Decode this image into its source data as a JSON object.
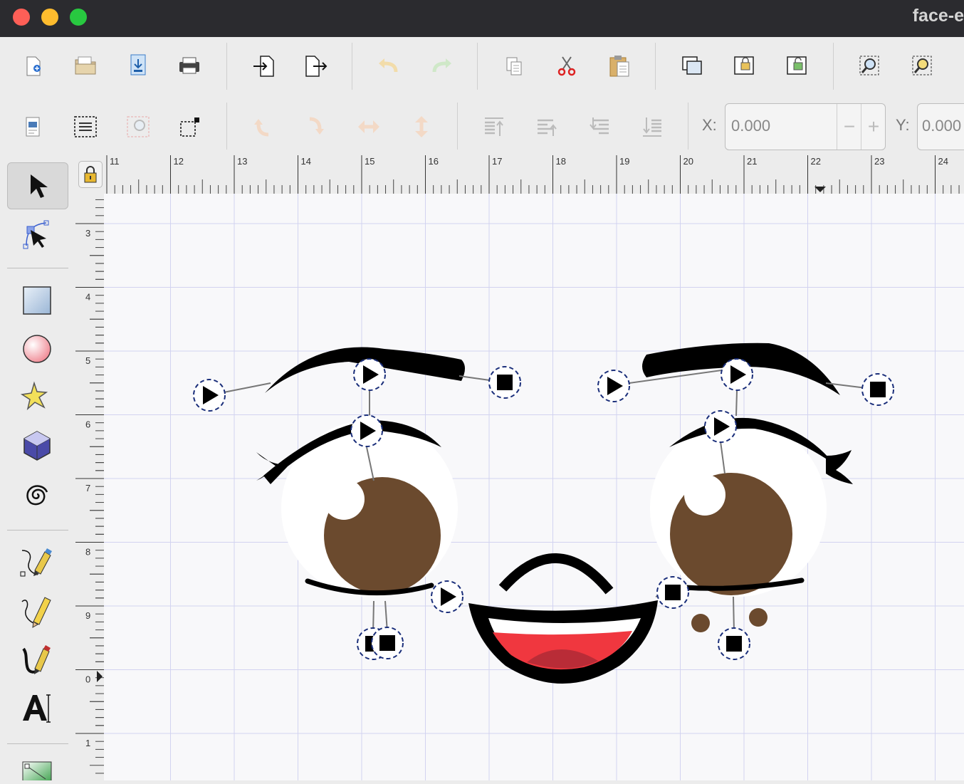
{
  "window": {
    "title": "face-e",
    "traffic_lights": [
      "close",
      "minimize",
      "zoom"
    ]
  },
  "toolbar": {
    "file_buttons": [
      "new-document",
      "open-document",
      "save-document",
      "print-document"
    ],
    "import_export_buttons": [
      "import",
      "export"
    ],
    "undo_redo_buttons": [
      "undo",
      "redo"
    ],
    "clipboard_buttons": [
      "copy",
      "cut",
      "paste"
    ],
    "group_buttons": [
      "duplicate",
      "group",
      "ungroup"
    ],
    "zoom_buttons": [
      "zoom-selection",
      "zoom-drawing"
    ]
  },
  "toolbar2": {
    "select_buttons": [
      "document-properties",
      "select-all",
      "select-same",
      "deselect"
    ],
    "transform_buttons": [
      "rotate-ccw",
      "rotate-cw",
      "flip-horizontal",
      "flip-vertical"
    ],
    "order_buttons": [
      "raise-to-top",
      "raise",
      "lower",
      "lower-to-bottom"
    ],
    "x_label": "X:",
    "x_value": "0.000",
    "y_label": "Y:",
    "y_value": "0.000",
    "minus": "−",
    "plus": "+"
  },
  "tools": [
    "selector",
    "node",
    "rectangle",
    "ellipse",
    "star",
    "3d-box",
    "spiral",
    "bezier-pen",
    "pencil",
    "calligraphy",
    "text",
    "gradient"
  ],
  "ruler": {
    "h_labels": [
      "11",
      "12",
      "13",
      "14",
      "15",
      "16",
      "17",
      "18",
      "19",
      "20",
      "21",
      "22",
      "23",
      "24"
    ],
    "v_labels": [
      "3",
      "4",
      "5",
      "6",
      "7",
      "8",
      "9",
      "0",
      "1"
    ]
  },
  "colors": {
    "iris": "#6b4a2e",
    "tongue": "#f0373f",
    "tongue_dark": "#b92c37",
    "handle_ring": "#1a2e7a",
    "grid": "#d2d3f0"
  }
}
